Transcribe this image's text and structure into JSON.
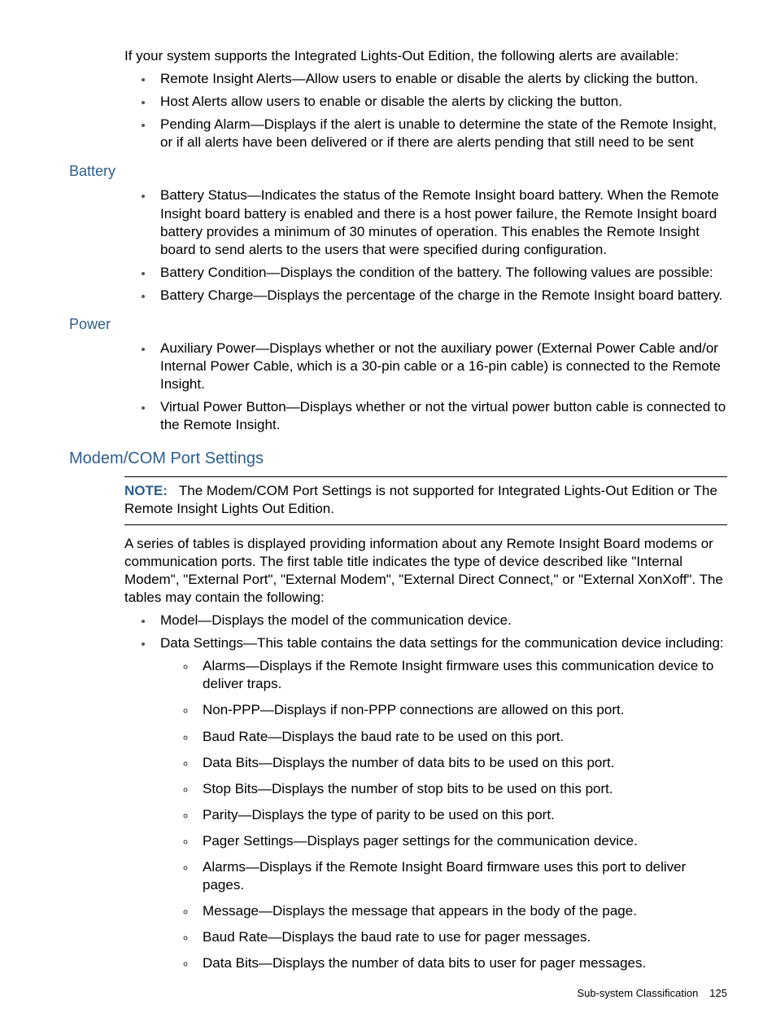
{
  "intro": "If your system supports the Integrated Lights-Out Edition, the following alerts are available:",
  "intro_bullets": [
    "Remote Insight Alerts—Allow users to enable or disable the alerts by clicking the button.",
    "Host Alerts allow users to enable or disable the alerts by clicking the button.",
    "Pending Alarm—Displays if the alert is unable to determine the state of the Remote Insight, or if all alerts have been delivered or if there are alerts pending that still need to be sent"
  ],
  "battery": {
    "heading": "Battery",
    "bullets": [
      "Battery Status—Indicates the status of the Remote Insight board battery. When the Remote Insight board battery is enabled and there is a host power failure, the Remote Insight board battery provides a minimum of 30 minutes of operation. This enables the Remote Insight board to send alerts to the users that were specified during configuration.",
      "Battery Condition—Displays the condition of the battery. The following values are possible:",
      "Battery Charge—Displays the percentage of the charge in the Remote Insight board battery."
    ]
  },
  "power": {
    "heading": "Power",
    "bullets": [
      "Auxiliary Power—Displays whether or not the auxiliary power  (External Power Cable and/or Internal Power Cable, which is a 30-pin cable or a 16-pin cable) is connected to the Remote Insight.",
      "Virtual Power Button—Displays whether or not the virtual power button cable is connected to the Remote Insight."
    ]
  },
  "modem": {
    "heading": "Modem/COM Port Settings",
    "note_label": "NOTE:",
    "note_text": "The Modem/COM Port Settings is not supported for Integrated Lights-Out Edition or The Remote Insight Lights Out Edition.",
    "para": "A series of tables is displayed providing information about any Remote Insight Board modems or communication ports. The first table title indicates the type of device described like \"Internal Modem\", \"External Port\", \"External Modem\", \"External Direct Connect,\" or \"External XonXoff\". The tables may contain the following:",
    "bullets": [
      "Model—Displays the model of the communication device.",
      "Data Settings—This table contains the data settings for the communication device including:"
    ],
    "sub_bullets": [
      "Alarms—Displays if the Remote Insight firmware uses this communication device to deliver traps.",
      "Non-PPP—Displays if non-PPP connections are allowed on this port.",
      "Baud Rate—Displays the baud rate to be used on this port.",
      "Data Bits—Displays the number of data bits to be used on this port.",
      "Stop Bits—Displays the number of stop bits to be used on this port.",
      "Parity—Displays the type of parity to be used on this port.",
      "Pager Settings—Displays pager settings for the communication device.",
      "Alarms—Displays if the Remote Insight Board firmware uses this port to deliver pages.",
      "Message—Displays the message that appears in the body of the page.",
      "Baud Rate—Displays the baud rate to use for pager messages.",
      "Data Bits—Displays the number of data bits to user for pager messages."
    ]
  },
  "footer": {
    "section": "Sub-system Classification",
    "page": "125"
  }
}
